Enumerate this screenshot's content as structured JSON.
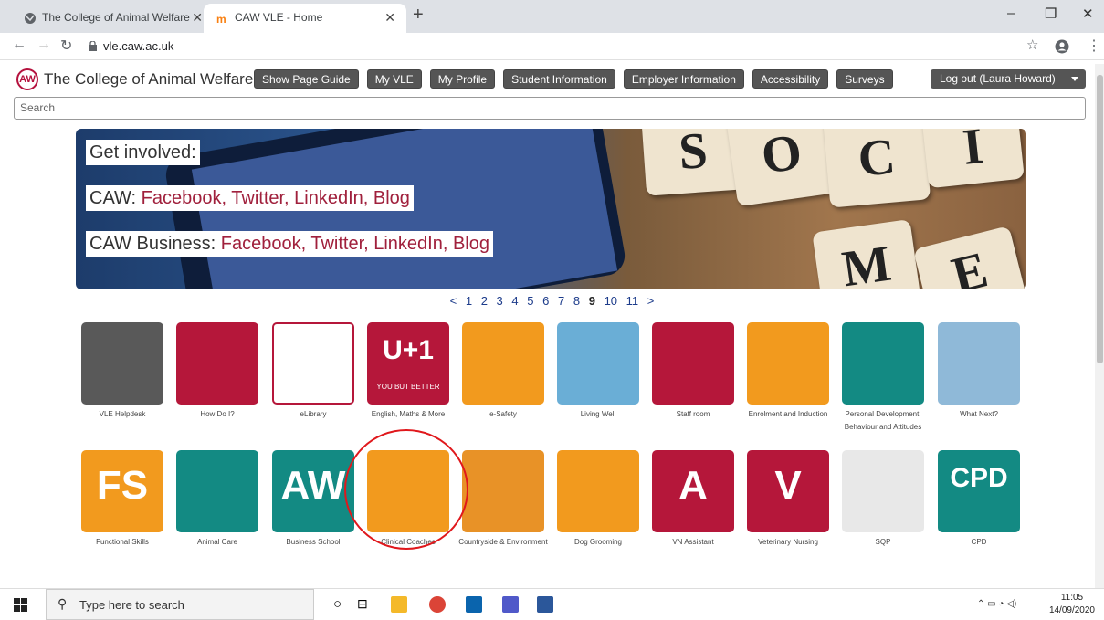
{
  "browser": {
    "tabs": [
      {
        "title": "The College of Animal Welfare",
        "icon": "globe-icon"
      },
      {
        "title": "CAW VLE - Home",
        "icon": "moodle-icon"
      }
    ],
    "url": "vle.caw.ac.uk",
    "window_controls": [
      "–",
      "❐",
      "✕"
    ]
  },
  "header": {
    "logo_mark": "AW",
    "site_name": "The College of Animal Welfare",
    "nav": [
      "Show Page Guide",
      "My VLE",
      "My Profile",
      "Student Information",
      "Employer Information",
      "Accessibility",
      "Surveys"
    ],
    "logout": "Log out (Laura Howard)"
  },
  "search": {
    "placeholder": "Search"
  },
  "banner": {
    "line1": "Get involved:",
    "line2_prefix": "CAW: ",
    "line2_links": "Facebook, Twitter, LinkedIn, Blog",
    "line3_prefix": "CAW Business: ",
    "line3_links": "Facebook, Twitter, LinkedIn, Blog",
    "tiles": [
      "S",
      "O",
      "C",
      "I",
      "M",
      "E"
    ]
  },
  "pager": {
    "prev": "<",
    "pages": [
      "1",
      "2",
      "3",
      "4",
      "5",
      "6",
      "7",
      "8",
      "9",
      "10",
      "11"
    ],
    "current": "9",
    "next": ">"
  },
  "tiles_row1": [
    {
      "label": "VLE Helpdesk",
      "bg": "#595959"
    },
    {
      "label": "How Do I?",
      "bg": "#b5173a"
    },
    {
      "label": "eLibrary",
      "bg": "#ffffff"
    },
    {
      "label": "English, Maths & More",
      "bg": "#b5173a",
      "text": "U+1",
      "sub": "YOU BUT BETTER"
    },
    {
      "label": "e-Safety",
      "bg": "#f29a1e"
    },
    {
      "label": "Living Well",
      "bg": "#6aaed6"
    },
    {
      "label": "Staff room",
      "bg": "#b5173a"
    },
    {
      "label": "Enrolment and Induction",
      "bg": "#f29a1e"
    },
    {
      "label": "Personal Development, Behaviour and Attitudes",
      "bg": "#138a83"
    },
    {
      "label": "What Next?",
      "bg": "#8fb9d8"
    }
  ],
  "tiles_row2": [
    {
      "label": "Functional Skills",
      "bg": "#f29a1e",
      "text": "FS"
    },
    {
      "label": "Animal Care",
      "bg": "#138a83"
    },
    {
      "label": "Business School",
      "bg": "#138a83",
      "text": "AW"
    },
    {
      "label": "Clinical Coaches",
      "bg": "#f29a1e"
    },
    {
      "label": "Countryside & Environment",
      "bg": "#e89227"
    },
    {
      "label": "Dog Grooming",
      "bg": "#f29a1e"
    },
    {
      "label": "VN Assistant",
      "bg": "#b5173a",
      "text": "A"
    },
    {
      "label": "Veterinary Nursing",
      "bg": "#b5173a",
      "text": "V"
    },
    {
      "label": "SQP",
      "bg": "#e8e8e8"
    },
    {
      "label": "CPD",
      "bg": "#138a83",
      "text": "CPD"
    }
  ],
  "taskbar": {
    "search_placeholder": "Type here to search",
    "time": "11:05",
    "date": "14/09/2020"
  }
}
